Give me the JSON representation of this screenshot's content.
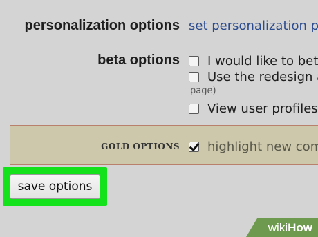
{
  "personalization": {
    "label": "personalization options",
    "link_text": "set personalization pr"
  },
  "beta": {
    "label": "beta options",
    "options": [
      {
        "text": "I would like to bet",
        "checked": false
      },
      {
        "text": "Use the redesign a",
        "checked": false
      },
      {
        "text": "View user profiles",
        "checked": false
      }
    ],
    "option_2_continuation": "page)"
  },
  "gold": {
    "label": "GOLD OPTIONS",
    "options": [
      {
        "text": "highlight new com",
        "checked": true
      }
    ]
  },
  "save_button": {
    "label": "save options"
  },
  "watermark": {
    "part1": "wiki",
    "part2": "How"
  },
  "colors": {
    "background": "#d4d4d4",
    "link": "#2a4b8d",
    "gold_band": "#cdc8ac",
    "highlight": "#14e21a",
    "watermark": "#6d9a4e"
  }
}
